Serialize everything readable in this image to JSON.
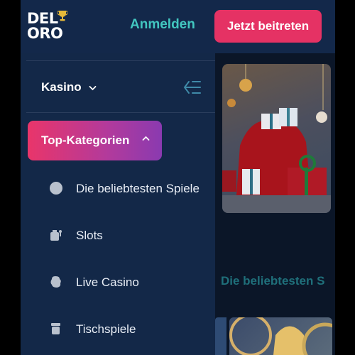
{
  "header": {
    "logo_line1": "DEL",
    "logo_line2": "ORO",
    "login_label": "Anmelden",
    "join_label": "Jetzt beitreten"
  },
  "drawer": {
    "casino_label": "Kasino",
    "top_categories_label": "Top-Kategorien",
    "items": [
      {
        "label": "Die beliebtesten Spiele",
        "icon": "circle-icon"
      },
      {
        "label": "Slots",
        "icon": "slots-icon"
      },
      {
        "label": "Live Casino",
        "icon": "live-casino-icon"
      },
      {
        "label": "Tischspiele",
        "icon": "table-games-icon"
      }
    ]
  },
  "content": {
    "section_title": "Die beliebtesten S"
  },
  "colors": {
    "accent_pink": "#e53264",
    "teal": "#42c7c0",
    "header_bg": "#13284a",
    "drawer_bg": "#132848"
  }
}
